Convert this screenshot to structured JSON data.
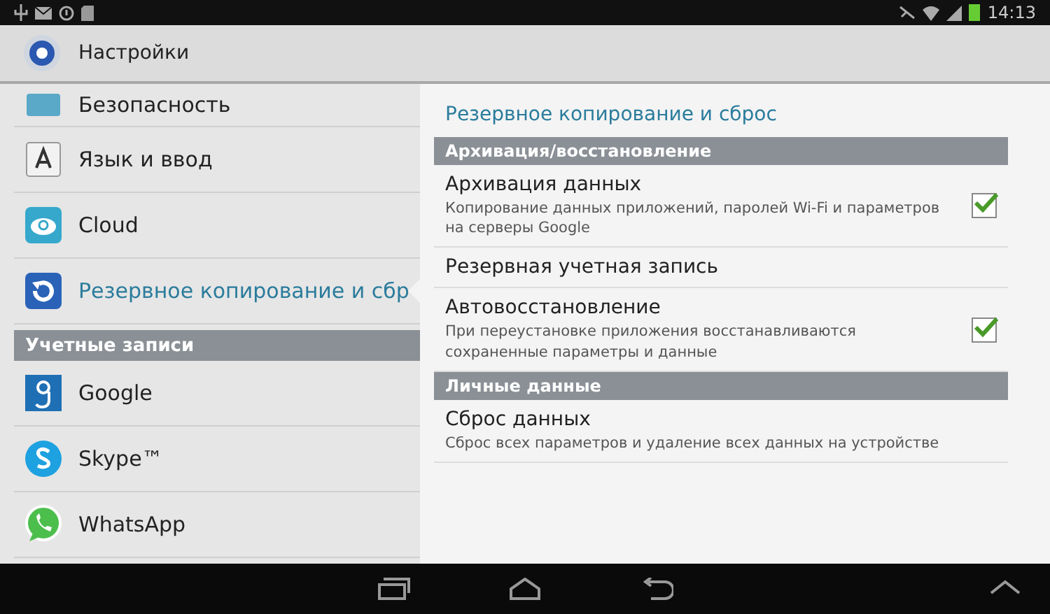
{
  "status_bar": {
    "time": "14:13"
  },
  "action_bar": {
    "title": "Настройки"
  },
  "sidebar": {
    "items": [
      {
        "kind": "item",
        "label": "Безопасность",
        "selected": false
      },
      {
        "kind": "item",
        "label": "Язык и ввод",
        "selected": false
      },
      {
        "kind": "item",
        "label": "Cloud",
        "selected": false
      },
      {
        "kind": "item",
        "label": "Резервное копирование и сбр",
        "selected": true
      },
      {
        "kind": "header",
        "label": "Учетные записи"
      },
      {
        "kind": "item",
        "label": "Google",
        "selected": false
      },
      {
        "kind": "item",
        "label": "Skype™",
        "selected": false
      },
      {
        "kind": "item",
        "label": "WhatsApp",
        "selected": false
      }
    ]
  },
  "detail": {
    "title": "Резервное копирование и сброс",
    "items": [
      {
        "kind": "header",
        "label": "Архивация/восстановление"
      },
      {
        "kind": "check",
        "title": "Архивация данных",
        "summary": "Копирование данных приложений, паролей Wi-Fi и параметров на серверы Google",
        "checked": true
      },
      {
        "kind": "plain",
        "title": "Резервная учетная запись"
      },
      {
        "kind": "check",
        "title": "Автовосстановление",
        "summary": "При переустановке приложения восстанавливаются сохраненные параметры и данные",
        "checked": true
      },
      {
        "kind": "header",
        "label": "Личные данные"
      },
      {
        "kind": "plain",
        "title": "Сброс данных",
        "summary": "Сброс всех параметров и удаление всех данных на устройстве"
      }
    ]
  }
}
